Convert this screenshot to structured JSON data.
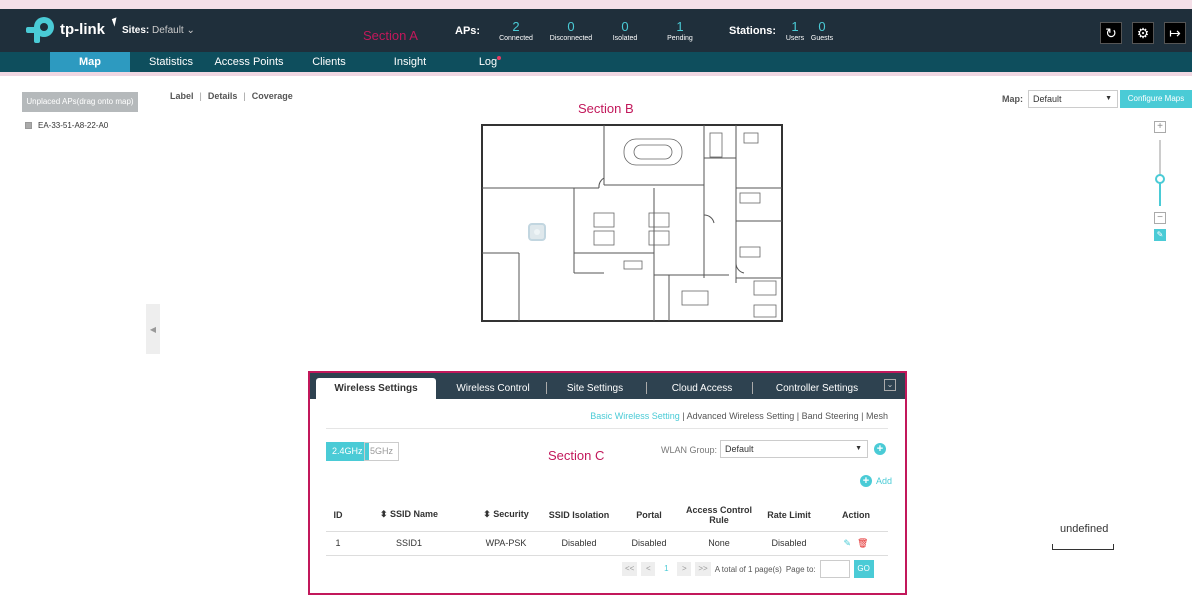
{
  "header": {
    "logo_text": "tp-link",
    "sites_label": "Sites:",
    "sites_value": "Default",
    "section_a": "Section A",
    "aps_label": "APs:",
    "aps": [
      {
        "value": "2",
        "label": "Connected"
      },
      {
        "value": "0",
        "label": "Disconnected"
      },
      {
        "value": "0",
        "label": "Isolated"
      },
      {
        "value": "1",
        "label": "Pending"
      }
    ],
    "stations_label": "Stations:",
    "stations": [
      {
        "value": "1",
        "label": "Users"
      },
      {
        "value": "0",
        "label": "Guests"
      }
    ],
    "icons": [
      "refresh-icon",
      "gear-icon",
      "logout-icon"
    ]
  },
  "nav": {
    "items": [
      "Map",
      "Statistics",
      "Access Points",
      "Clients",
      "Insight",
      "Log"
    ],
    "active": "Map"
  },
  "left": {
    "unplaced_label": "Unplaced APs(drag onto map)",
    "ap_mac": "EA-33-51-A8-22-A0"
  },
  "map": {
    "views": [
      "Label",
      "Details",
      "Coverage"
    ],
    "section_b": "Section B",
    "map_label": "Map:",
    "map_value": "Default",
    "configure_label": "Configure Maps",
    "scale_label": "undefined"
  },
  "settings": {
    "tabs": [
      "Wireless Settings",
      "Wireless Control",
      "Site Settings",
      "Cloud Access",
      "Controller Settings"
    ],
    "subnav": [
      "Basic Wireless Setting",
      "Advanced Wireless Setting",
      "Band Steering",
      "Mesh"
    ],
    "bands": [
      "2.4GHz",
      "5GHz"
    ],
    "section_c": "Section C",
    "wlan_label": "WLAN Group:",
    "wlan_value": "Default",
    "add_label": "Add",
    "columns": [
      "ID",
      "⬍ SSID Name",
      "⬍ Security",
      "SSID Isolation",
      "Portal",
      "Access Control Rule",
      "Rate Limit",
      "Action"
    ],
    "rows": [
      {
        "id": "1",
        "ssid": "SSID1",
        "security": "WPA-PSK",
        "isolation": "Disabled",
        "portal": "Disabled",
        "acl": "None",
        "rate": "Disabled"
      }
    ],
    "pager": {
      "first": "<<",
      "prev": "<",
      "page": "1",
      "next": ">",
      "last": ">>",
      "total": "A total of 1 page(s)",
      "page_to": "Page to:",
      "go": "GO"
    }
  }
}
